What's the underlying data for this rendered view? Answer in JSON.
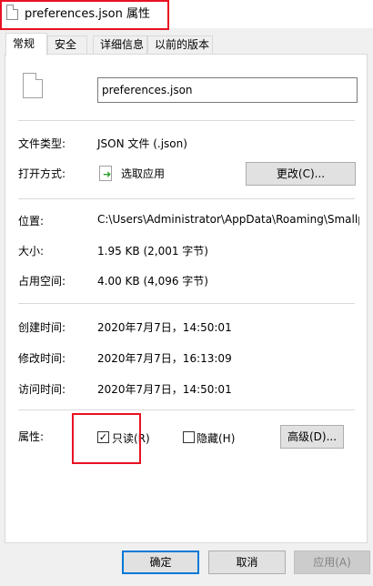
{
  "window": {
    "title": "preferences.json 属性"
  },
  "tabs": [
    {
      "label": "常规"
    },
    {
      "label": "安全"
    },
    {
      "label": "详细信息"
    },
    {
      "label": "以前的版本"
    }
  ],
  "general": {
    "file_name": "preferences.json",
    "type_label": "文件类型:",
    "type_value": "JSON 文件 (.json)",
    "open_with_label": "打开方式:",
    "open_with_value": "选取应用",
    "change_button": "更改(C)...",
    "location_label": "位置:",
    "location_value": "C:\\Users\\Administrator\\AppData\\Roaming\\Smallp",
    "size_label": "大小:",
    "size_value": "1.95 KB (2,001 字节)",
    "size_on_disk_label": "占用空间:",
    "size_on_disk_value": "4.00 KB (4,096 字节)",
    "created_label": "创建时间:",
    "created_value": "2020年7月7日，14:50:01",
    "modified_label": "修改时间:",
    "modified_value": "2020年7月7日，16:13:09",
    "accessed_label": "访问时间:",
    "accessed_value": "2020年7月7日，14:50:01",
    "attributes_label": "属性:",
    "readonly_label": "只读(R)",
    "readonly_checked": true,
    "hidden_label": "隐藏(H)",
    "hidden_checked": false,
    "advanced_button": "高级(D)..."
  },
  "footer": {
    "ok": "确定",
    "cancel": "取消",
    "apply": "应用(A)"
  },
  "colors": {
    "annotation": "#e81123",
    "primary_border": "#0078d7"
  }
}
